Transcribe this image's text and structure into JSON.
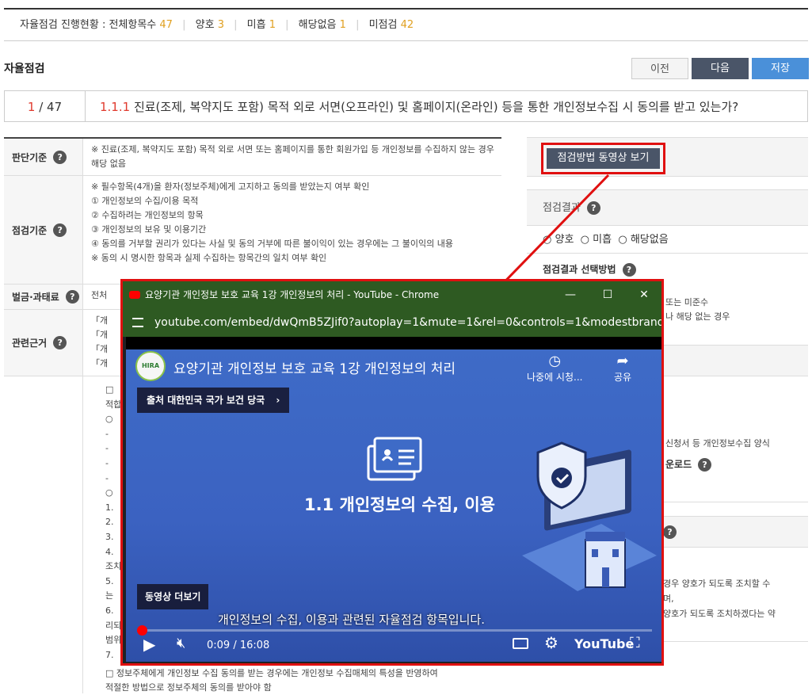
{
  "progress": {
    "label": "자율점검 진행현황 : 전체항목수",
    "total": "47",
    "good_label": "양호",
    "good": "3",
    "bad_label": "미흡",
    "bad": "1",
    "na_label": "해당없음",
    "na": "1",
    "unchecked_label": "미점검",
    "unchecked": "42"
  },
  "section_title": "자율점검",
  "buttons": {
    "prev": "이전",
    "next": "다음",
    "save": "저장"
  },
  "question": {
    "current": "1",
    "total": "/ 47",
    "number": "1.1.1",
    "text": "진료(조제, 복약지도 포함) 목적 외로 서면(오프라인) 및 홈페이지(온라인) 등을 통한 개인정보수집 시 동의를 받고 있는가?"
  },
  "left_table": {
    "judge_label": "판단기준",
    "judge_text": "※ 진료(조제, 복약지도 포함) 목적 외로 서면 또는 홈페이지를 통한 회원가입 등 개인정보를 수집하지 않는 경우 해당 없음",
    "check_label": "점검기준",
    "check_lines": [
      "※ 필수항목(4개)을 환자(정보주체)에게 고지하고 동의를 받았는지 여부 확인",
      "① 개인정보의 수집/이용 목적",
      "② 수집하려는 개인정보의 항목",
      "③ 개인정보의 보유 및 이용기간",
      "④ 동의를 거부할 권리가 있다는 사실 및 동의 거부에 따른 불이익이 있는 경우에는 그 불이익의 내용",
      "※ 동의 시 명시한 항목과 실제 수집하는 항목간의 일치 여부 확인"
    ],
    "penalty_label": "벌금·과태료",
    "penalty_text": "전처",
    "law_label": "관련근거",
    "law_lines": [
      "「개",
      "「개",
      "「개",
      "「개"
    ],
    "guide_lines": [
      "□",
      "적합",
      "○",
      "-",
      "-",
      "-",
      "-",
      "○",
      "1.",
      "2.",
      "3.",
      "4.",
      "조치",
      "5.",
      "는",
      "6.",
      "리되",
      "범위",
      "7."
    ],
    "bottom_lines": [
      "□ 정보주체에게 개인정보 수집 동의를 받는 경우에는 개인정보 수집매체의 특성을 반영하여",
      "적절한 방법으로 정보주체의 동의를 받아야 함"
    ]
  },
  "right_panel": {
    "video_button": "점검방법 동영상 보기",
    "result_label": "점검결과",
    "options": [
      "양호",
      "미흡",
      "해당없음"
    ],
    "method_label": "점검결과 선택방법",
    "method_lines": [
      "또는 미준수",
      "나 해당 없는 경우"
    ],
    "form_text": "신청서 등 개인정보수집 양식",
    "download_text": "운로드",
    "notice_lines": [
      "경우 양호가 되도록 조치할 수",
      "며,",
      "양호가 되도록 조치하겠다는 약"
    ]
  },
  "popup": {
    "window_title": "요양기관 개인정보 보호 교육 1강 개인정보의 처리 - YouTube - Chrome",
    "url": "youtube.com/embed/dwQmB5ZJif0?autoplay=1&mute=1&rel=0&controls=1&modestbranding...",
    "minimize": "—",
    "restore": "☐",
    "close": "✕",
    "video_title": "요양기관 개인정보 보호 교육 1강 개인정보의 처리",
    "channel_badge": "HIRA",
    "watch_later": "나중에 시청...",
    "share": "공유",
    "source": "출처 대한민국 국가 보건 당국",
    "source_chevron": "›",
    "heading": "1.1 개인정보의 수집, 이용",
    "more_videos": "동영상 더보기",
    "caption": "개인정보의 수집, 이용과 관련된 자율점검 항목입니다.",
    "time": "0:09 / 16:08",
    "progress": 0.009,
    "brand": "YouTube"
  }
}
